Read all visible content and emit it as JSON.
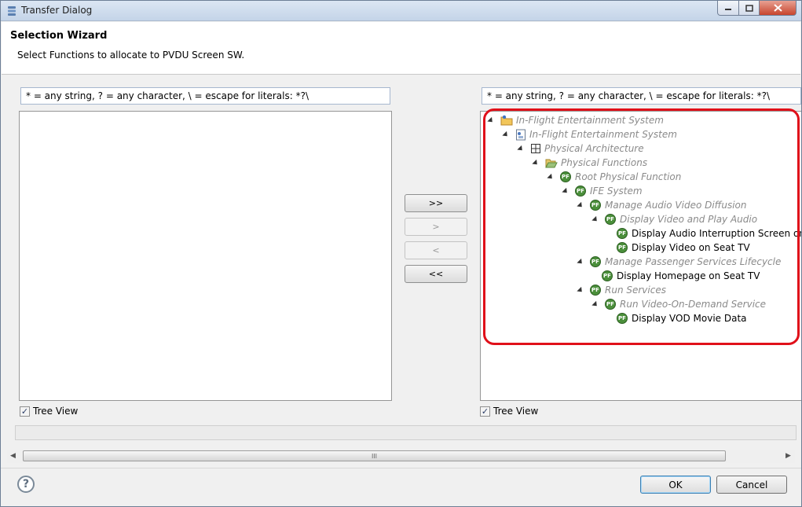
{
  "window": {
    "title": "Transfer Dialog"
  },
  "header": {
    "title": "Selection Wizard",
    "description": "Select Functions to allocate to PVDU Screen SW."
  },
  "left_panel": {
    "filter_value": "* = any string, ? = any character, \\ = escape for literals: *?\\",
    "tree_view_label": "Tree View",
    "tree_view_checked": true
  },
  "right_panel": {
    "filter_value": "* = any string, ? = any character, \\ = escape for literals: *?\\",
    "tree_view_label": "Tree View",
    "tree_view_checked": true,
    "tree": [
      {
        "label": "In-Flight Entertainment System",
        "icon": "project-folder-icon",
        "style": "grey",
        "expanded": true
      },
      {
        "label": "In-Flight Entertainment System",
        "icon": "system-model-icon",
        "style": "grey",
        "expanded": true
      },
      {
        "label": "Physical Architecture",
        "icon": "architecture-grid-icon",
        "style": "grey",
        "expanded": true
      },
      {
        "label": "Physical Functions",
        "icon": "open-folder-icon",
        "style": "grey",
        "expanded": true
      },
      {
        "label": "Root Physical Function",
        "icon": "pf-icon",
        "style": "grey",
        "expanded": true
      },
      {
        "label": "IFE System",
        "icon": "pf-icon",
        "style": "grey",
        "expanded": true
      },
      {
        "label": "Manage Audio Video Diffusion",
        "icon": "pf-icon",
        "style": "grey",
        "expanded": true
      },
      {
        "label": "Display Video and Play Audio",
        "icon": "pf-icon",
        "style": "grey",
        "expanded": true
      },
      {
        "label": "Display Audio Interruption Screen on Se",
        "icon": "pf-icon",
        "style": "normal",
        "expanded": false
      },
      {
        "label": "Display Video on Seat TV",
        "icon": "pf-icon",
        "style": "normal",
        "expanded": false
      },
      {
        "label": "Manage Passenger Services Lifecycle",
        "icon": "pf-icon",
        "style": "grey",
        "expanded": true
      },
      {
        "label": "Display Homepage on Seat TV",
        "icon": "pf-icon",
        "style": "normal",
        "expanded": false
      },
      {
        "label": "Run Services",
        "icon": "pf-icon",
        "style": "grey",
        "expanded": true
      },
      {
        "label": "Run Video-On-Demand Service",
        "icon": "pf-icon",
        "style": "grey",
        "expanded": true
      },
      {
        "label": "Display VOD Movie Data",
        "icon": "pf-icon",
        "style": "normal",
        "expanded": false
      }
    ]
  },
  "transfer_buttons": {
    "add_all": ">>",
    "add": ">",
    "remove": "<",
    "remove_all": "<<"
  },
  "scrollbar": {
    "thumb_grip": "III"
  },
  "footer": {
    "ok_label": "OK",
    "cancel_label": "Cancel",
    "help_glyph": "?"
  },
  "colors": {
    "highlight_border": "#e0101a",
    "pf_icon_green": "#4b8f3b"
  }
}
